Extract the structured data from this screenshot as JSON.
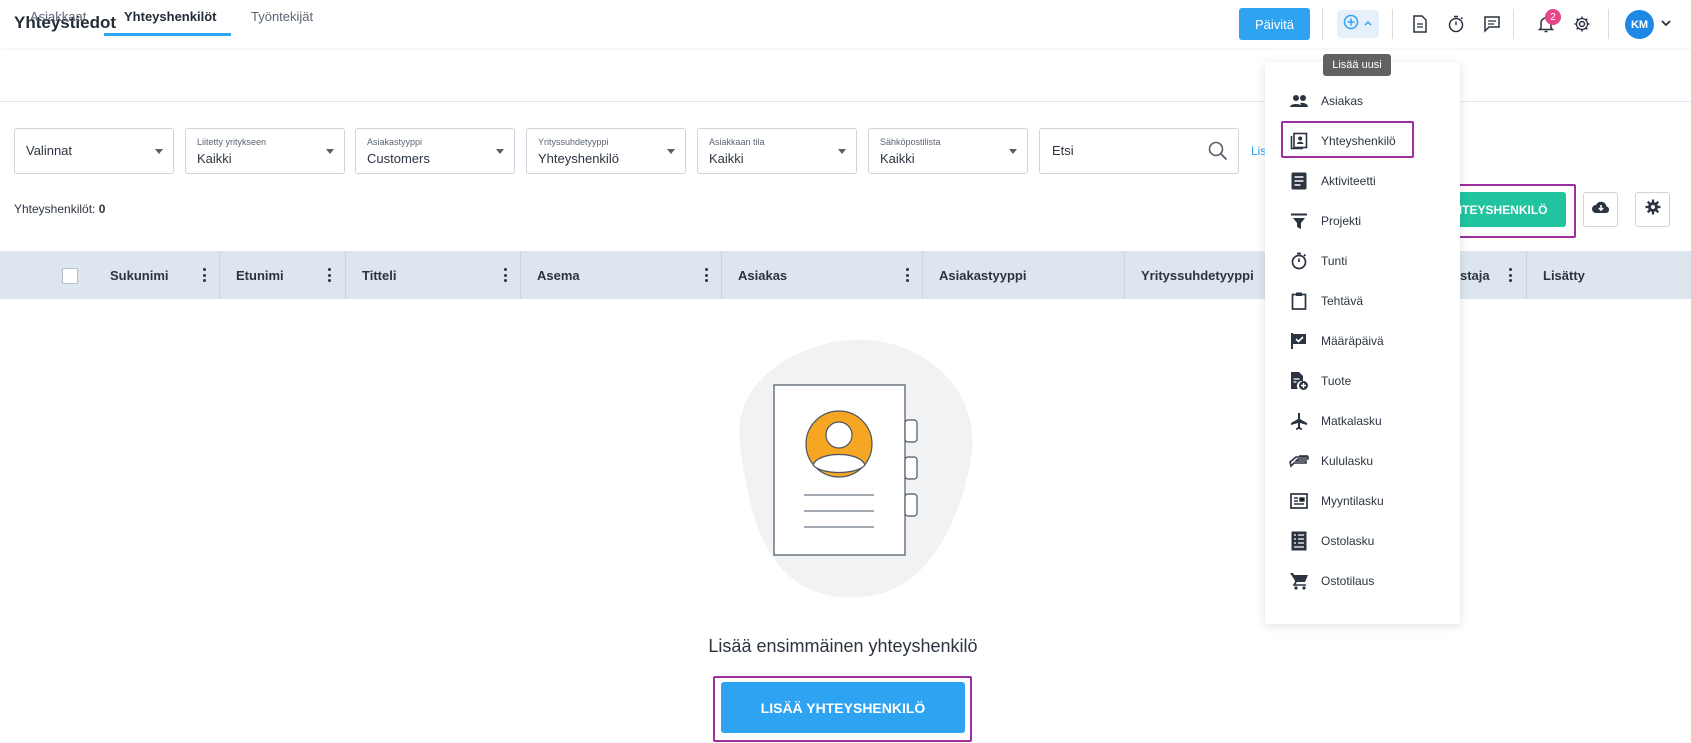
{
  "header": {
    "title": "Yhteystiedot",
    "update_button": "Päivitä",
    "notification_count": "2",
    "avatar_initials": "KM",
    "tooltip": "Lisää uusi"
  },
  "tabs": [
    {
      "label": "Asiakkaat",
      "active": false
    },
    {
      "label": "Yhteyshenkilöt",
      "active": true
    },
    {
      "label": "Työntekijät",
      "active": false
    }
  ],
  "filters": {
    "options": {
      "value": "Valinnat"
    },
    "linked_company": {
      "label": "Liitetty yritykseen",
      "value": "Kaikki"
    },
    "customer_type": {
      "label": "Asiakastyyppi",
      "value": "Customers"
    },
    "relationship_type": {
      "label": "Yrityssuhdetyyppi",
      "value": "Yhteyshenkilö"
    },
    "customer_status": {
      "label": "Asiakkaan tila",
      "value": "Kaikki"
    },
    "mailing_list": {
      "label": "Sähköpostilista",
      "value": "Kaikki"
    },
    "search_placeholder": "Etsi",
    "link_partial": "Lis"
  },
  "summary": {
    "count_label": "Yhteyshenkilöt:",
    "count_value": "0"
  },
  "actions": {
    "add_contact_partial": "HTEYSHENKILÖ"
  },
  "table": {
    "columns": [
      "Sukunimi",
      "Etunimi",
      "Titteli",
      "Asema",
      "Asiakas",
      "Asiakastyyppi",
      "Yrityssuhdetyyppi",
      "staja",
      "Lisätty"
    ]
  },
  "empty_state": {
    "message": "Lisää ensimmäinen yhteyshenkilö",
    "button": "LISÄÄ YHTEYSHENKILÖ"
  },
  "add_menu": {
    "items": [
      {
        "label": "Asiakas",
        "icon": "people-icon"
      },
      {
        "label": "Yhteyshenkilö",
        "icon": "contact-card-icon"
      },
      {
        "label": "Aktiviteetti",
        "icon": "document-lines-icon"
      },
      {
        "label": "Projekti",
        "icon": "funnel-icon"
      },
      {
        "label": "Tunti",
        "icon": "stopwatch-icon"
      },
      {
        "label": "Tehtävä",
        "icon": "clipboard-icon"
      },
      {
        "label": "Määräpäivä",
        "icon": "flag-check-icon"
      },
      {
        "label": "Tuote",
        "icon": "product-add-icon"
      },
      {
        "label": "Matkalasku",
        "icon": "airplane-icon"
      },
      {
        "label": "Kululasku",
        "icon": "hand-money-icon"
      },
      {
        "label": "Myyntilasku",
        "icon": "invoice-icon"
      },
      {
        "label": "Ostolasku",
        "icon": "receipt-icon"
      },
      {
        "label": "Ostotilaus",
        "icon": "cart-icon"
      }
    ]
  },
  "colors": {
    "primary": "#2ea3f2",
    "success": "#22c4a0",
    "highlight": "#9c2e9e",
    "badge": "#e9458a",
    "table_header_bg": "#dde6ef"
  }
}
